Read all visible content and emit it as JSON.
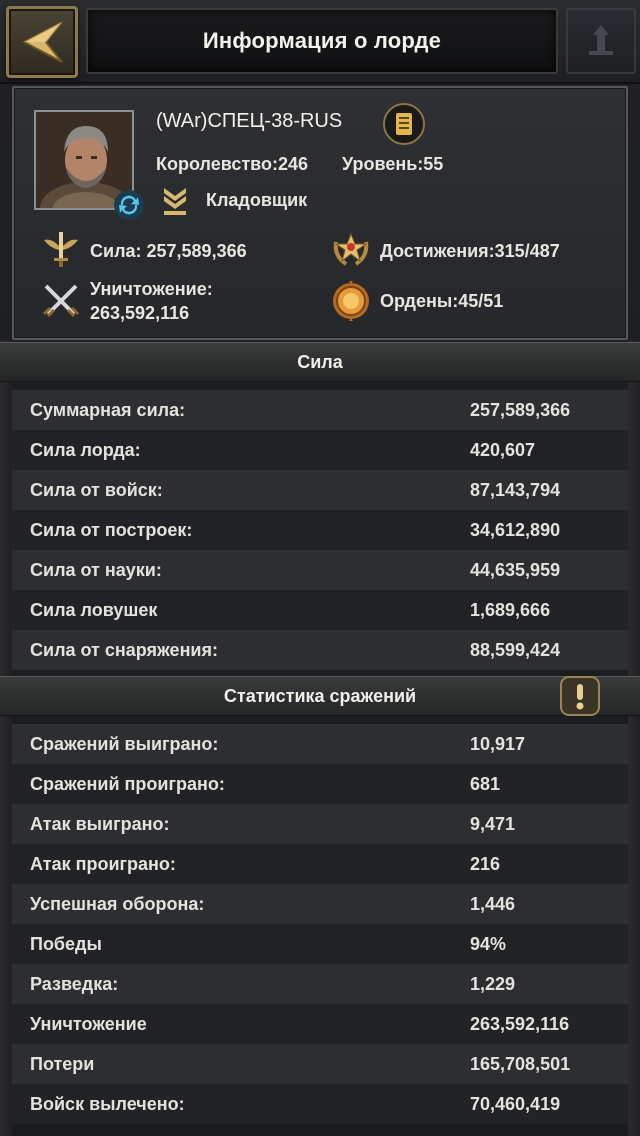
{
  "header": {
    "title": "Информация о лорде"
  },
  "profile": {
    "name": "(WAr)СПЕЦ-38-RUS",
    "kingdom": "Королевство:246",
    "level": "Уровень:55",
    "rank_title": "Кладовщик",
    "power": "Сила: 257,589,366",
    "achievements": "Достижения:315/487",
    "kills_label": "Уничтожение:",
    "kills_value": "263,592,116",
    "medals": "Ордены:45/51"
  },
  "power_section": {
    "title": "Сила",
    "rows": [
      {
        "label": "Суммарная сила:",
        "value": "257,589,366"
      },
      {
        "label": "Сила лорда:",
        "value": "420,607"
      },
      {
        "label": "Сила от войск:",
        "value": "87,143,794"
      },
      {
        "label": "Сила от построек:",
        "value": "34,612,890"
      },
      {
        "label": "Сила от науки:",
        "value": "44,635,959"
      },
      {
        "label": "Сила ловушек",
        "value": "1,689,666"
      },
      {
        "label": "Сила от снаряжения:",
        "value": "88,599,424"
      }
    ]
  },
  "battle_section": {
    "title": "Статистика сражений",
    "rows": [
      {
        "label": "Сражений выиграно:",
        "value": "10,917"
      },
      {
        "label": "Сражений проиграно:",
        "value": "681"
      },
      {
        "label": "Атак выиграно:",
        "value": "9,471"
      },
      {
        "label": "Атак проиграно:",
        "value": "216"
      },
      {
        "label": "Успешная оборона:",
        "value": "1,446"
      },
      {
        "label": "Победы",
        "value": "94%"
      },
      {
        "label": "Разведка:",
        "value": "1,229"
      },
      {
        "label": "Уничтожение",
        "value": "263,592,116"
      },
      {
        "label": "Потери",
        "value": "165,708,501"
      },
      {
        "label": "Войск вылечено:",
        "value": "70,460,419"
      }
    ]
  },
  "icons": {
    "back": "back-arrow-icon",
    "report": "document-icon",
    "refresh": "refresh-icon",
    "rank": "rank-chevron-icon",
    "power": "winged-sword-icon",
    "achievements": "star-laurel-icon",
    "kills": "crossed-swords-icon",
    "medals": "medal-icon",
    "info": "exclamation-icon"
  },
  "colors": {
    "gold": "#c9a45a",
    "text": "#e8e6e0",
    "row_odd": "#2c2e31",
    "row_even": "#222326"
  }
}
